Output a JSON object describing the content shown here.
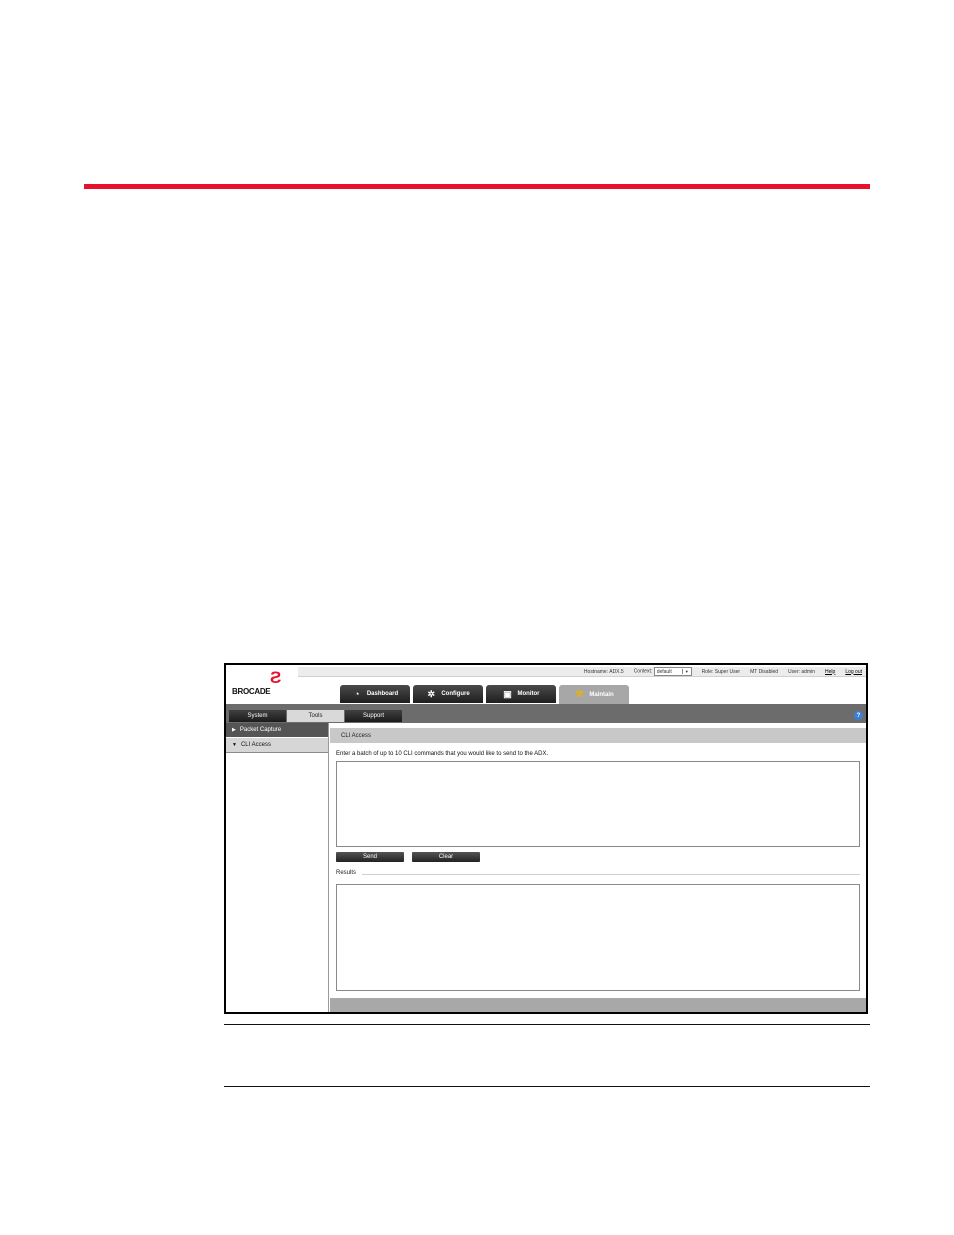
{
  "header": {
    "hostname_label": "Hostname:",
    "hostname_value": "ADX.5",
    "context_label": "Context:",
    "context_value": "default",
    "role_label": "Role:",
    "role_value": "Super User",
    "status_text": "MT Disabled",
    "user_label": "User:",
    "user_value": "admin",
    "help_link": "Help",
    "logout_link": "Log out"
  },
  "logo": {
    "text": "BROCADE"
  },
  "main_tabs": [
    {
      "label": "Dashboard",
      "icon": "dashboard-icon"
    },
    {
      "label": "Configure",
      "icon": "gear-icon"
    },
    {
      "label": "Monitor",
      "icon": "monitor-icon"
    },
    {
      "label": "Maintain",
      "icon": "tools-icon",
      "active": true
    }
  ],
  "sub_tabs": [
    {
      "label": "System"
    },
    {
      "label": "Tools",
      "active": true
    },
    {
      "label": "Support"
    }
  ],
  "sidebar": {
    "items": [
      {
        "label": "Packet Capture",
        "expanded": false
      },
      {
        "label": "CLI Access",
        "expanded": true
      }
    ]
  },
  "panel": {
    "title": "CLI Access",
    "instruction": "Enter a batch of up to 10 CLI commands that you would like to send to the ADX.",
    "commands_value": "",
    "send_label": "Send",
    "clear_label": "Clear",
    "results_label": "Results",
    "results_value": ""
  },
  "colors": {
    "accent": "#e8112d",
    "tab_dark": "#1e1e1e",
    "bar_gray": "#6c6c6c"
  }
}
